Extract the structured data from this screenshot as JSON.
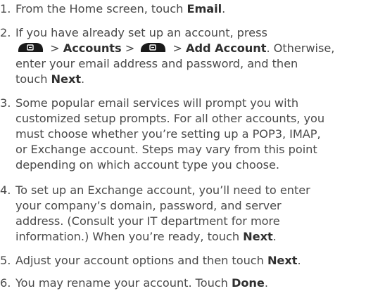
{
  "steps": [
    {
      "number": "1.",
      "lines": [
        {
          "pre": "From the Home screen, touch ",
          "bold": "Email",
          "post": "."
        }
      ]
    },
    {
      "number": "2.",
      "lines": [
        {
          "text": "If you have already set up an account, press"
        },
        {
          "sep1": " > ",
          "bold1": "Accounts",
          "sep2": " > ",
          "sep3": " > ",
          "bold2": "Add Account",
          "post": ". Otherwise,"
        },
        {
          "text": "enter your email address and password, and then"
        },
        {
          "pre": "touch ",
          "bold": "Next",
          "post": "."
        }
      ],
      "icon": "menu-key-icon"
    },
    {
      "number": "3.",
      "lines": [
        {
          "text": "Some popular email services will prompt you with"
        },
        {
          "text": "customized setup prompts. For all other accounts, you"
        },
        {
          "text": "must choose whether you’re setting up a POP3, IMAP,"
        },
        {
          "text": "or Exchange account. Steps may vary from this point"
        },
        {
          "text": "depending on which account type you choose."
        }
      ]
    },
    {
      "number": "4.",
      "lines": [
        {
          "text": "To set up an Exchange account, you’ll need to enter"
        },
        {
          "text": "your company’s domain, password, and server"
        },
        {
          "text": "address. (Consult your IT department for more"
        },
        {
          "pre": "information.) When you’re ready, touch ",
          "bold": "Next",
          "post": "."
        }
      ]
    },
    {
      "number": "5.",
      "lines": [
        {
          "pre": "Adjust your account options and then touch ",
          "bold": "Next",
          "post": "."
        }
      ]
    },
    {
      "number": "6.",
      "lines": [
        {
          "pre": "You may rename your account. Touch ",
          "bold": "Done",
          "post": "."
        }
      ]
    }
  ]
}
